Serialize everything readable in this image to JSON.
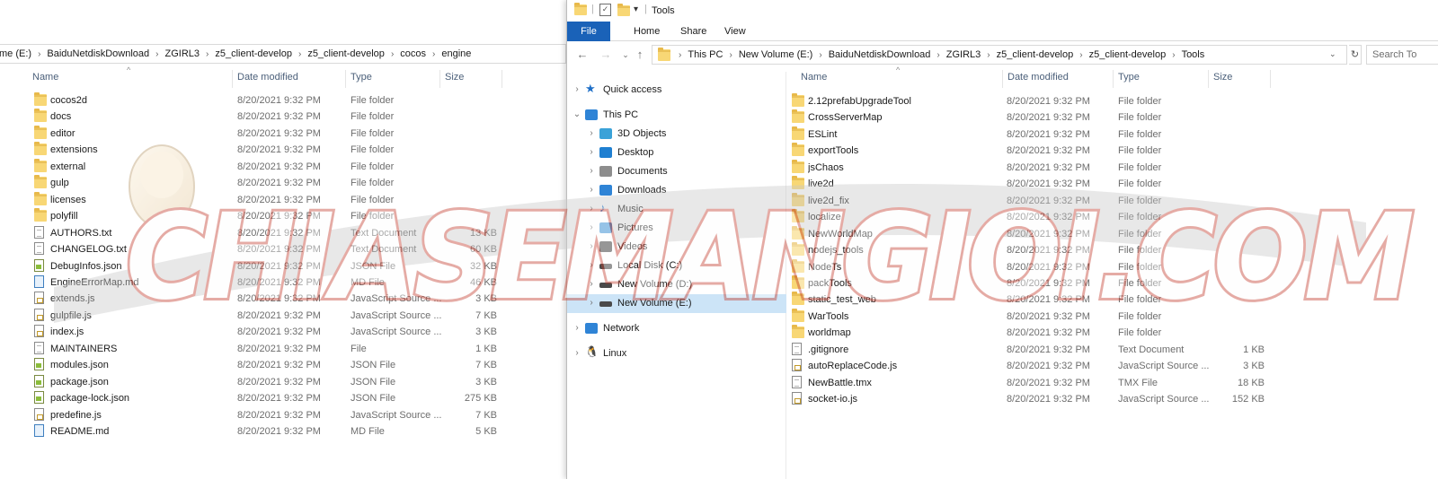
{
  "left": {
    "breadcrumb": [
      "me (E:)",
      "BaiduNetdiskDownload",
      "ZGIRL3",
      "z5_client-develop",
      "z5_client-develop",
      "cocos",
      "engine"
    ],
    "columns": {
      "name": "Name",
      "date": "Date modified",
      "type": "Type",
      "size": "Size"
    },
    "files": [
      {
        "name": "cocos2d",
        "date": "8/20/2021 9:32 PM",
        "type": "File folder",
        "size": "",
        "icon": "folder"
      },
      {
        "name": "docs",
        "date": "8/20/2021 9:32 PM",
        "type": "File folder",
        "size": "",
        "icon": "folder"
      },
      {
        "name": "editor",
        "date": "8/20/2021 9:32 PM",
        "type": "File folder",
        "size": "",
        "icon": "folder"
      },
      {
        "name": "extensions",
        "date": "8/20/2021 9:32 PM",
        "type": "File folder",
        "size": "",
        "icon": "folder"
      },
      {
        "name": "external",
        "date": "8/20/2021 9:32 PM",
        "type": "File folder",
        "size": "",
        "icon": "folder"
      },
      {
        "name": "gulp",
        "date": "8/20/2021 9:32 PM",
        "type": "File folder",
        "size": "",
        "icon": "folder"
      },
      {
        "name": "licenses",
        "date": "8/20/2021 9:32 PM",
        "type": "File folder",
        "size": "",
        "icon": "folder"
      },
      {
        "name": "polyfill",
        "date": "8/20/2021 9:32 PM",
        "type": "File folder",
        "size": "",
        "icon": "folder"
      },
      {
        "name": "AUTHORS.txt",
        "date": "8/20/2021 9:32 PM",
        "type": "Text Document",
        "size": "13 KB",
        "icon": "doc"
      },
      {
        "name": "CHANGELOG.txt",
        "date": "8/20/2021 9:32 PM",
        "type": "Text Document",
        "size": "60 KB",
        "icon": "doc"
      },
      {
        "name": "DebugInfos.json",
        "date": "8/20/2021 9:32 PM",
        "type": "JSON File",
        "size": "32 KB",
        "icon": "json"
      },
      {
        "name": "EngineErrorMap.md",
        "date": "8/20/2021 9:32 PM",
        "type": "MD File",
        "size": "46 KB",
        "icon": "md"
      },
      {
        "name": "extends.js",
        "date": "8/20/2021 9:32 PM",
        "type": "JavaScript Source ...",
        "size": "3 KB",
        "icon": "js"
      },
      {
        "name": "gulpfile.js",
        "date": "8/20/2021 9:32 PM",
        "type": "JavaScript Source ...",
        "size": "7 KB",
        "icon": "js"
      },
      {
        "name": "index.js",
        "date": "8/20/2021 9:32 PM",
        "type": "JavaScript Source ...",
        "size": "3 KB",
        "icon": "js"
      },
      {
        "name": "MAINTAINERS",
        "date": "8/20/2021 9:32 PM",
        "type": "File",
        "size": "1 KB",
        "icon": "doc"
      },
      {
        "name": "modules.json",
        "date": "8/20/2021 9:32 PM",
        "type": "JSON File",
        "size": "7 KB",
        "icon": "json"
      },
      {
        "name": "package.json",
        "date": "8/20/2021 9:32 PM",
        "type": "JSON File",
        "size": "3 KB",
        "icon": "json"
      },
      {
        "name": "package-lock.json",
        "date": "8/20/2021 9:32 PM",
        "type": "JSON File",
        "size": "275 KB",
        "icon": "json"
      },
      {
        "name": "predefine.js",
        "date": "8/20/2021 9:32 PM",
        "type": "JavaScript Source ...",
        "size": "7 KB",
        "icon": "js"
      },
      {
        "name": "README.md",
        "date": "8/20/2021 9:32 PM",
        "type": "MD File",
        "size": "5 KB",
        "icon": "md"
      }
    ]
  },
  "right": {
    "title": "Tools",
    "ribbon_tabs": [
      "File",
      "Home",
      "Share",
      "View"
    ],
    "breadcrumb": [
      "This PC",
      "New Volume (E:)",
      "BaiduNetdiskDownload",
      "ZGIRL3",
      "z5_client-develop",
      "z5_client-develop",
      "Tools"
    ],
    "search_placeholder": "Search To",
    "columns": {
      "name": "Name",
      "date": "Date modified",
      "type": "Type",
      "size": "Size"
    },
    "nav": [
      {
        "label": "Quick access",
        "icon": "star-icon",
        "level": 0,
        "chevron": "›"
      },
      {
        "label": "This PC",
        "icon": "computer-icon",
        "level": 0,
        "chevron": "⌄"
      },
      {
        "label": "3D Objects",
        "icon": "cube-icon",
        "level": 1,
        "chevron": "›"
      },
      {
        "label": "Desktop",
        "icon": "desktop-icon",
        "level": 1,
        "chevron": "›"
      },
      {
        "label": "Documents",
        "icon": "documents-icon",
        "level": 1,
        "chevron": "›"
      },
      {
        "label": "Downloads",
        "icon": "download-icon",
        "level": 1,
        "chevron": "›"
      },
      {
        "label": "Music",
        "icon": "music-icon",
        "level": 1,
        "chevron": "›"
      },
      {
        "label": "Pictures",
        "icon": "pictures-icon",
        "level": 1,
        "chevron": "›"
      },
      {
        "label": "Videos",
        "icon": "videos-icon",
        "level": 1,
        "chevron": "›"
      },
      {
        "label": "Local Disk (C:)",
        "icon": "drive-icon",
        "level": 1,
        "chevron": "›"
      },
      {
        "label": "New Volume (D:)",
        "icon": "drive-icon",
        "level": 1,
        "chevron": "›"
      },
      {
        "label": "New Volume (E:)",
        "icon": "drive-icon",
        "level": 1,
        "chevron": "›",
        "selected": true
      },
      {
        "label": "Network",
        "icon": "network-icon",
        "level": 0,
        "chevron": "›"
      },
      {
        "label": "Linux",
        "icon": "linux-icon",
        "level": 0,
        "chevron": "›"
      }
    ],
    "files": [
      {
        "name": "2.12prefabUpgradeTool",
        "date": "8/20/2021 9:32 PM",
        "type": "File folder",
        "size": "",
        "icon": "folder"
      },
      {
        "name": "CrossServerMap",
        "date": "8/20/2021 9:32 PM",
        "type": "File folder",
        "size": "",
        "icon": "folder"
      },
      {
        "name": "ESLint",
        "date": "8/20/2021 9:32 PM",
        "type": "File folder",
        "size": "",
        "icon": "folder"
      },
      {
        "name": "exportTools",
        "date": "8/20/2021 9:32 PM",
        "type": "File folder",
        "size": "",
        "icon": "folder"
      },
      {
        "name": "jsChaos",
        "date": "8/20/2021 9:32 PM",
        "type": "File folder",
        "size": "",
        "icon": "folder"
      },
      {
        "name": "live2d",
        "date": "8/20/2021 9:32 PM",
        "type": "File folder",
        "size": "",
        "icon": "folder"
      },
      {
        "name": "live2d_fix",
        "date": "8/20/2021 9:32 PM",
        "type": "File folder",
        "size": "",
        "icon": "folder"
      },
      {
        "name": "localize",
        "date": "8/20/2021 9:32 PM",
        "type": "File folder",
        "size": "",
        "icon": "folder"
      },
      {
        "name": "NewWorldMap",
        "date": "8/20/2021 9:32 PM",
        "type": "File folder",
        "size": "",
        "icon": "folder"
      },
      {
        "name": "nodejs_tools",
        "date": "8/20/2021 9:32 PM",
        "type": "File folder",
        "size": "",
        "icon": "folder"
      },
      {
        "name": "NodeTs",
        "date": "8/20/2021 9:32 PM",
        "type": "File folder",
        "size": "",
        "icon": "folder"
      },
      {
        "name": "packTools",
        "date": "8/20/2021 9:32 PM",
        "type": "File folder",
        "size": "",
        "icon": "folder"
      },
      {
        "name": "static_test_web",
        "date": "8/20/2021 9:32 PM",
        "type": "File folder",
        "size": "",
        "icon": "folder"
      },
      {
        "name": "WarTools",
        "date": "8/20/2021 9:32 PM",
        "type": "File folder",
        "size": "",
        "icon": "folder"
      },
      {
        "name": "worldmap",
        "date": "8/20/2021 9:32 PM",
        "type": "File folder",
        "size": "",
        "icon": "folder"
      },
      {
        "name": ".gitignore",
        "date": "8/20/2021 9:32 PM",
        "type": "Text Document",
        "size": "1 KB",
        "icon": "doc"
      },
      {
        "name": "autoReplaceCode.js",
        "date": "8/20/2021 9:32 PM",
        "type": "JavaScript Source ...",
        "size": "3 KB",
        "icon": "js"
      },
      {
        "name": "NewBattle.tmx",
        "date": "8/20/2021 9:32 PM",
        "type": "TMX File",
        "size": "18 KB",
        "icon": "doc"
      },
      {
        "name": "socket-io.js",
        "date": "8/20/2021 9:32 PM",
        "type": "JavaScript Source ...",
        "size": "152 KB",
        "icon": "js"
      }
    ]
  },
  "watermark": {
    "text": "CHIASEMANGIOI.COM"
  }
}
